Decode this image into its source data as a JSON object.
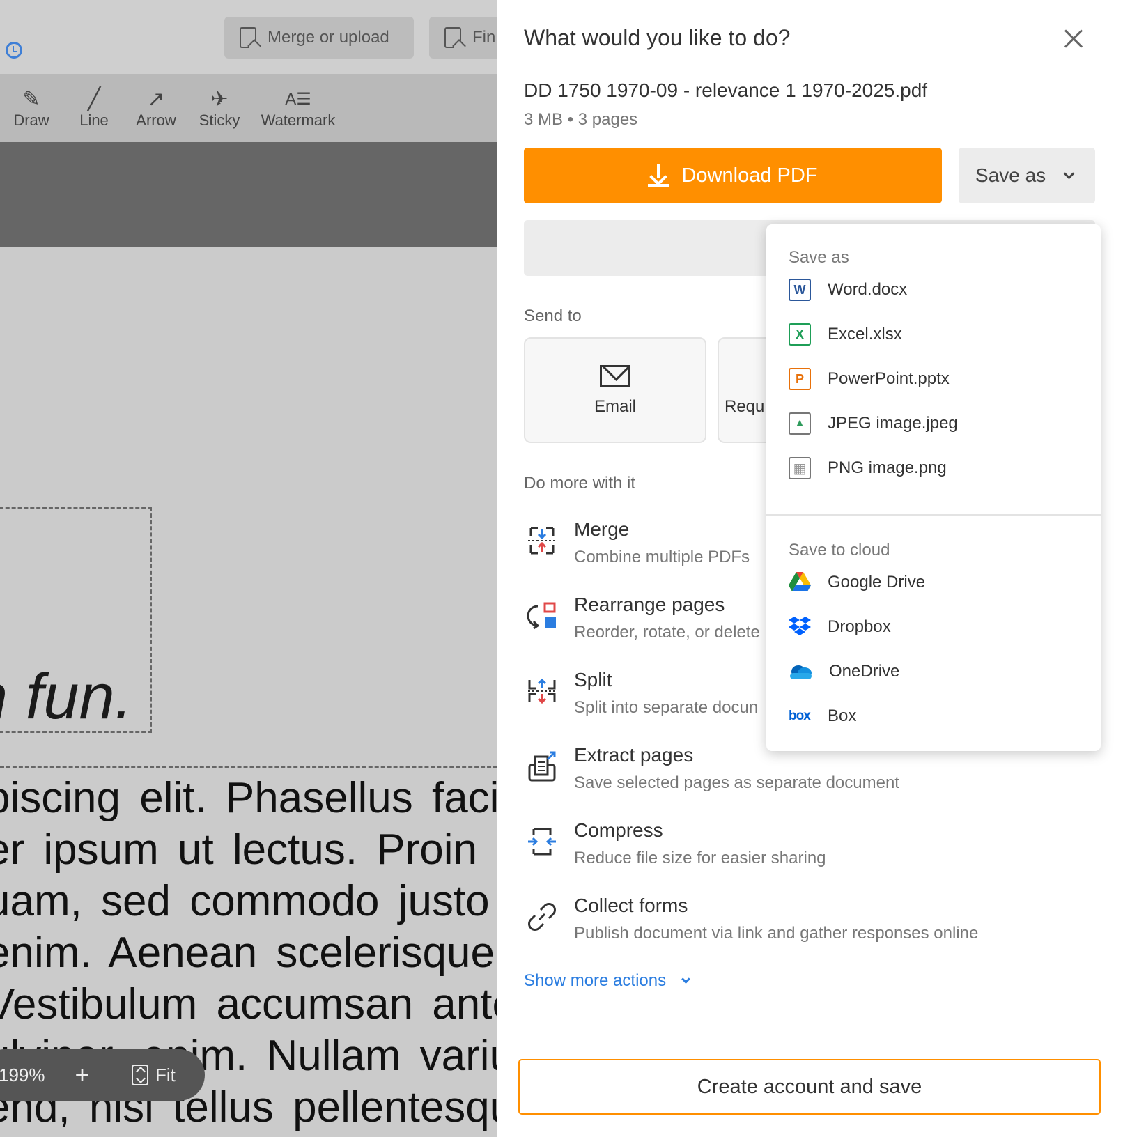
{
  "editor": {
    "top_buttons": [
      {
        "label": "Merge or upload"
      },
      {
        "label": "Fin"
      }
    ],
    "tools": [
      {
        "label": "Draw",
        "icon": "brush-icon"
      },
      {
        "label": "Line",
        "icon": "line-icon"
      },
      {
        "label": "Arrow",
        "icon": "arrow-icon"
      },
      {
        "label": "Sticky",
        "icon": "pin-icon"
      },
      {
        "label": "Watermark",
        "icon": "watermark-icon"
      }
    ],
    "doc_heading_fragment": "n fun.",
    "doc_lines": [
      "piscing elit. Phasellus facilis",
      "er ipsum ut lectus. Proin alic",
      "uam, sed commodo justo",
      "enim. Aenean scelerisque",
      "Vestibulum accumsan ante",
      "ulvinar, enim. Nullam varius",
      "end, nisi tellus pellentesqu"
    ],
    "zoom": {
      "value": "199%",
      "plus": "+",
      "fit": "Fit"
    }
  },
  "panel": {
    "title": "What would you like to do?",
    "file_name": "DD 1750 1970-09 - relevance 1 1970-2025.pdf",
    "file_meta": "3 MB • 3 pages",
    "download_label": "Download PDF",
    "saveas_label": "Save as",
    "send_to_label": "Send to",
    "send_cards": [
      {
        "label": "Email"
      },
      {
        "label": "Requ"
      }
    ],
    "do_more_label": "Do more with it",
    "actions": [
      {
        "name": "Merge",
        "desc": "Combine multiple PDFs"
      },
      {
        "name": "Rearrange pages",
        "desc": "Reorder, rotate, or delete"
      },
      {
        "name": "Split",
        "desc": "Split into separate docun"
      },
      {
        "name": "Extract pages",
        "desc": "Save selected pages as separate document"
      },
      {
        "name": "Compress",
        "desc": "Reduce file size for easier sharing"
      },
      {
        "name": "Collect forms",
        "desc": "Publish document via link and gather responses online"
      }
    ],
    "show_more": "Show more actions",
    "create_account": "Create account and save"
  },
  "dropdown": {
    "save_as_header": "Save as",
    "save_as_items": [
      {
        "label": "Word.docx",
        "icon": "word-icon",
        "glyph": "W",
        "color": "#2b579a"
      },
      {
        "label": "Excel.xlsx",
        "icon": "excel-icon",
        "glyph": "X",
        "color": "#1e9e57"
      },
      {
        "label": "PowerPoint.pptx",
        "icon": "powerpoint-icon",
        "glyph": "P",
        "color": "#e8710a"
      },
      {
        "label": "JPEG image.jpeg",
        "icon": "jpeg-image-icon",
        "glyph": "▲",
        "color": "#2e9b5c"
      },
      {
        "label": "PNG image.png",
        "icon": "png-image-icon",
        "glyph": "▦",
        "color": "#888888"
      }
    ],
    "cloud_header": "Save to cloud",
    "cloud_items": [
      {
        "label": "Google Drive",
        "icon": "google-drive-icon"
      },
      {
        "label": "Dropbox",
        "icon": "dropbox-icon"
      },
      {
        "label": "OneDrive",
        "icon": "onedrive-icon"
      },
      {
        "label": "Box",
        "icon": "box-icon",
        "glyph": "box"
      }
    ]
  },
  "colors": {
    "accent_orange": "#ff8f00",
    "link_blue": "#2b7de0"
  }
}
